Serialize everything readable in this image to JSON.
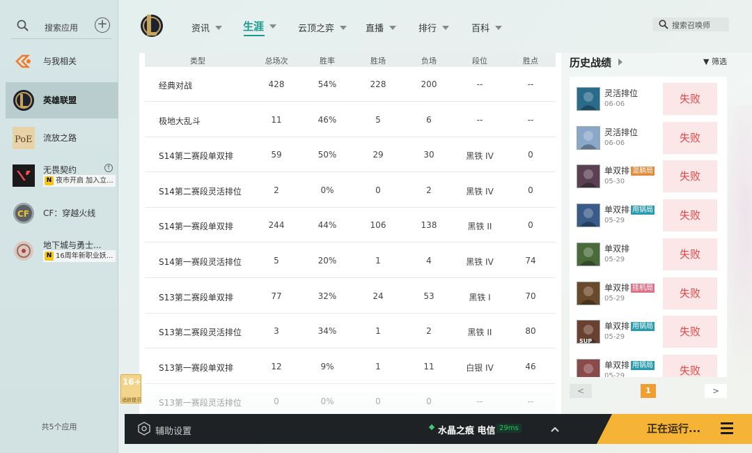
{
  "sidebar": {
    "search_placeholder": "搜索应用",
    "apps": [
      {
        "name": "与我相关"
      },
      {
        "name": "英雄联盟"
      },
      {
        "name": "流放之路"
      },
      {
        "name": "无畏契约",
        "sub": "夜市开启 加入立..."
      },
      {
        "name": "CF：穿越火线"
      },
      {
        "name": "地下城与勇士...",
        "sub": "16周年新职业妖..."
      }
    ],
    "app_count": "共5个应用"
  },
  "nav": {
    "items": [
      "资讯",
      "生涯",
      "云顶之弈",
      "直播",
      "排行",
      "百科"
    ],
    "active": "生涯",
    "search_placeholder": "搜索召唤师"
  },
  "stats": {
    "columns": [
      "类型",
      "总场次",
      "胜率",
      "胜场",
      "负场",
      "段位",
      "胜点"
    ],
    "rows": [
      [
        "经典对战",
        "428",
        "54%",
        "228",
        "200",
        "--",
        "--"
      ],
      [
        "极地大乱斗",
        "11",
        "46%",
        "5",
        "6",
        "--",
        "--"
      ],
      [
        "S14第二赛段单双排",
        "59",
        "50%",
        "29",
        "30",
        "黑铁 IV",
        "0"
      ],
      [
        "S14第二赛段灵活排位",
        "2",
        "0%",
        "0",
        "2",
        "黑铁 IV",
        "0"
      ],
      [
        "S14第一赛段单双排",
        "244",
        "44%",
        "106",
        "138",
        "黑铁 II",
        "0"
      ],
      [
        "S14第一赛段灵活排位",
        "5",
        "20%",
        "1",
        "4",
        "黑铁 IV",
        "74"
      ],
      [
        "S13第二赛段单双排",
        "77",
        "32%",
        "24",
        "53",
        "黑铁 I",
        "70"
      ],
      [
        "S13第二赛段灵活排位",
        "3",
        "34%",
        "1",
        "2",
        "黑铁 II",
        "80"
      ],
      [
        "S13第一赛段单双排",
        "12",
        "9%",
        "1",
        "11",
        "白银 IV",
        "46"
      ],
      [
        "S13第一赛段灵活排位",
        "0",
        "0%",
        "0",
        "0",
        "--",
        "--"
      ]
    ]
  },
  "history": {
    "title": "历史战绩",
    "filter_label": "筛选",
    "matches": [
      {
        "mode": "灵活排位",
        "date": "06-06",
        "tag": "",
        "result": "失败",
        "color": "#2a6a8a"
      },
      {
        "mode": "灵活排位",
        "date": "06-06",
        "tag": "",
        "result": "失败",
        "color": "#8aa6c8"
      },
      {
        "mode": "单双排",
        "date": "05-30",
        "tag": "混躺局",
        "tag_color": "#e08a3a",
        "result": "失败",
        "color": "#5a4050"
      },
      {
        "mode": "单双排",
        "date": "05-29",
        "tag": "用锅局",
        "tag_color": "#2a9ab0",
        "result": "失败",
        "color": "#3a5a8a"
      },
      {
        "mode": "单双排",
        "date": "05-29",
        "tag": "",
        "result": "失败",
        "color": "#4a6a3a"
      },
      {
        "mode": "单双排",
        "date": "05-29",
        "tag": "挂机局",
        "tag_color": "#e0708a",
        "result": "失败",
        "color": "#6a4a2a"
      },
      {
        "mode": "单双排",
        "date": "05-29",
        "tag": "用锅局",
        "tag_color": "#2a9ab0",
        "result": "失败",
        "color": "#6a4030",
        "badge": "SUP"
      },
      {
        "mode": "单双排",
        "date": "05-29",
        "tag": "用锅局",
        "tag_color": "#2a9ab0",
        "result": "失败",
        "color": "#8a4a4a"
      }
    ],
    "pagination": {
      "prev": "<",
      "current": "1",
      "next": ">"
    }
  },
  "age_badge": {
    "rating": "16+",
    "note": "适龄提示"
  },
  "bottom": {
    "assist_label": "辅助设置",
    "server": "水晶之痕 电信",
    "ping": "29ms",
    "running_label": "正在运行..."
  },
  "colors": {
    "accent": "#1a9a8e",
    "loss": "#e04848",
    "running": "#f5b436"
  }
}
